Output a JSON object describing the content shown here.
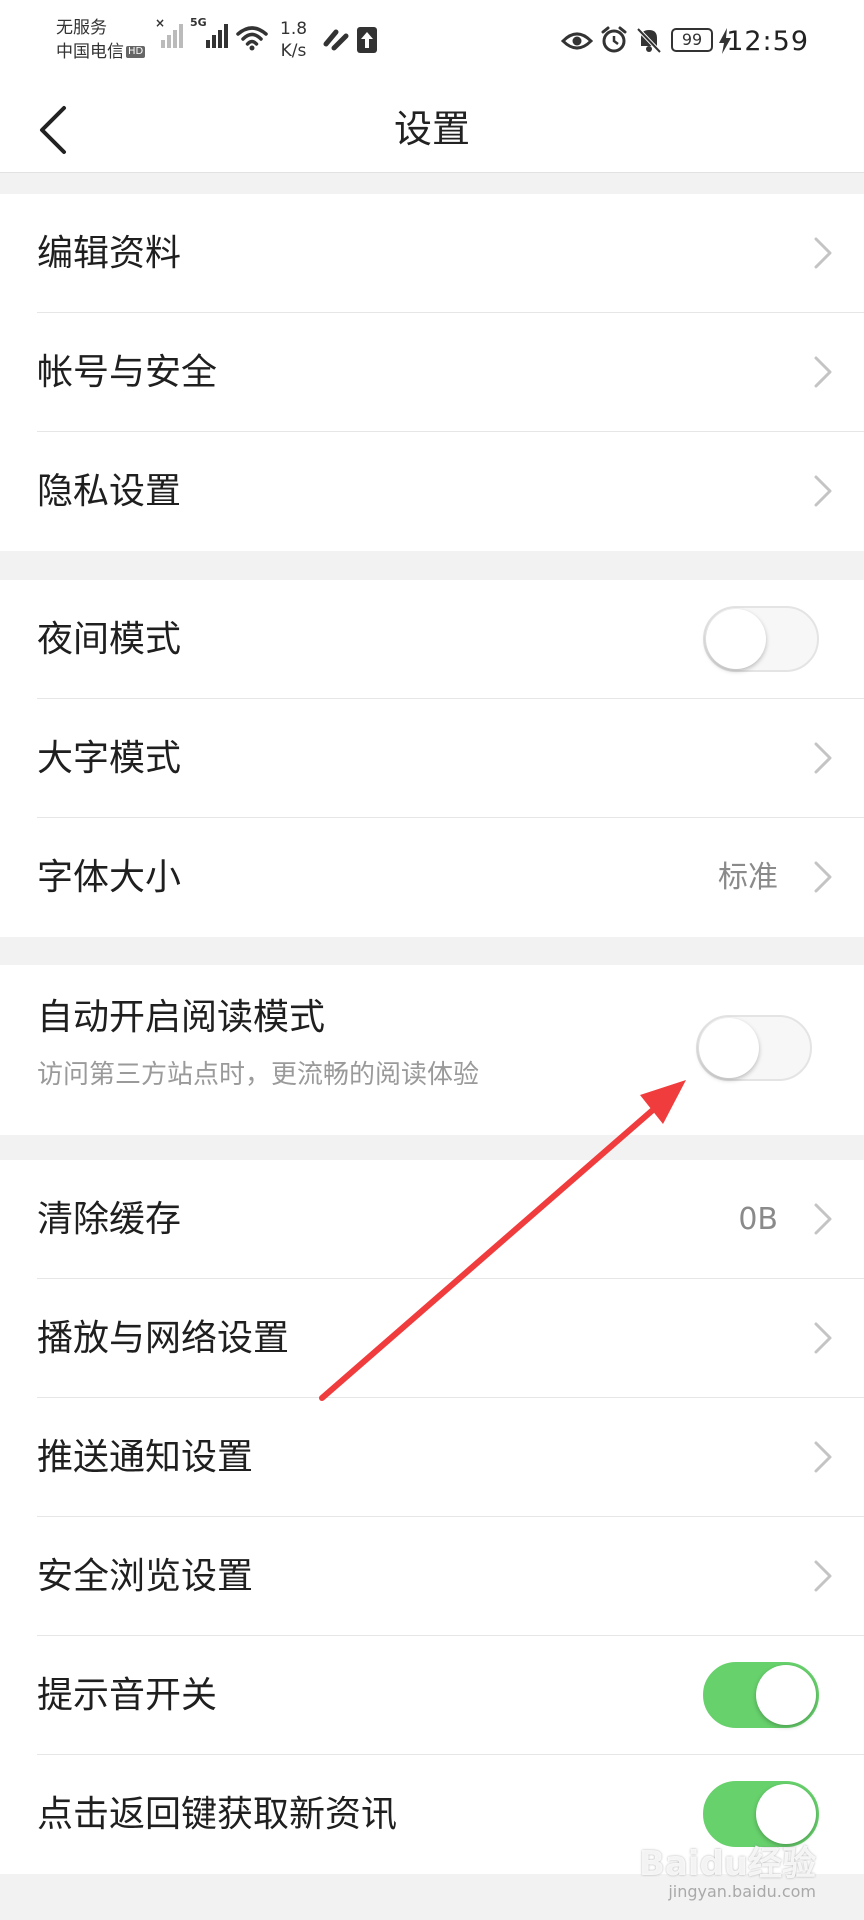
{
  "status_bar": {
    "carrier_line1": "无服务",
    "carrier_line2": "中国电信",
    "hd_badge": "HD",
    "network_type": "5G",
    "speed_value": "1.8",
    "speed_unit": "K/s",
    "battery": "99",
    "time": "12:59"
  },
  "app_bar": {
    "title": "设置",
    "back_icon": "chevron-left-icon"
  },
  "groups": [
    {
      "items": [
        {
          "label": "编辑资料",
          "type": "link"
        },
        {
          "label": "帐号与安全",
          "type": "link"
        },
        {
          "label": "隐私设置",
          "type": "link"
        }
      ]
    },
    {
      "items": [
        {
          "label": "夜间模式",
          "type": "toggle",
          "on": false
        },
        {
          "label": "大字模式",
          "type": "link"
        },
        {
          "label": "字体大小",
          "type": "link",
          "value": "标准"
        }
      ]
    },
    {
      "items": [
        {
          "label": "自动开启阅读模式",
          "subtitle": "访问第三方站点时，更流畅的阅读体验",
          "type": "toggle",
          "on": false
        }
      ]
    },
    {
      "items": [
        {
          "label": "清除缓存",
          "type": "link",
          "value": "0B"
        },
        {
          "label": "播放与网络设置",
          "type": "link"
        },
        {
          "label": "推送通知设置",
          "type": "link"
        },
        {
          "label": "安全浏览设置",
          "type": "link"
        },
        {
          "label": "提示音开关",
          "type": "toggle",
          "on": true
        },
        {
          "label": "点击返回键获取新资讯",
          "type": "toggle",
          "on": true
        }
      ]
    }
  ],
  "annotation": {
    "arrow_color": "#f03c3c"
  },
  "watermark": {
    "text": "Baidu经验",
    "sub": "jingyan.baidu.com"
  },
  "colors": {
    "toggle_on": "#67d16c",
    "background": "#f2f2f2"
  }
}
